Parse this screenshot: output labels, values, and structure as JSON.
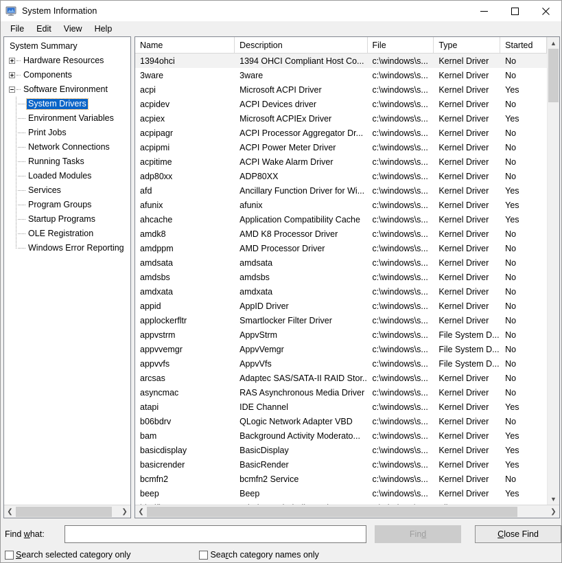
{
  "window": {
    "title": "System Information",
    "icon": "computer-monitor-icon",
    "controls": {
      "minimize": "minimize-icon",
      "maximize": "maximize-icon",
      "close": "close-icon"
    }
  },
  "menubar": {
    "items": [
      "File",
      "Edit",
      "View",
      "Help"
    ]
  },
  "tree": {
    "items": [
      {
        "label": "System Summary",
        "level": 0,
        "expander": "none",
        "selected": false
      },
      {
        "label": "Hardware Resources",
        "level": 1,
        "expander": "plus",
        "selected": false
      },
      {
        "label": "Components",
        "level": 1,
        "expander": "plus",
        "selected": false
      },
      {
        "label": "Software Environment",
        "level": 1,
        "expander": "minus",
        "selected": false
      },
      {
        "label": "System Drivers",
        "level": 2,
        "expander": "leaf",
        "selected": true
      },
      {
        "label": "Environment Variables",
        "level": 2,
        "expander": "leaf",
        "selected": false
      },
      {
        "label": "Print Jobs",
        "level": 2,
        "expander": "leaf",
        "selected": false
      },
      {
        "label": "Network Connections",
        "level": 2,
        "expander": "leaf",
        "selected": false
      },
      {
        "label": "Running Tasks",
        "level": 2,
        "expander": "leaf",
        "selected": false
      },
      {
        "label": "Loaded Modules",
        "level": 2,
        "expander": "leaf",
        "selected": false
      },
      {
        "label": "Services",
        "level": 2,
        "expander": "leaf",
        "selected": false
      },
      {
        "label": "Program Groups",
        "level": 2,
        "expander": "leaf",
        "selected": false
      },
      {
        "label": "Startup Programs",
        "level": 2,
        "expander": "leaf",
        "selected": false
      },
      {
        "label": "OLE Registration",
        "level": 2,
        "expander": "leaf",
        "selected": false
      },
      {
        "label": "Windows Error Reporting",
        "level": 2,
        "expander": "leaf",
        "selected": false
      }
    ]
  },
  "list": {
    "columns": [
      "Name",
      "Description",
      "File",
      "Type",
      "Started"
    ],
    "rows": [
      [
        "1394ohci",
        "1394 OHCI Compliant Host Co...",
        "c:\\windows\\s...",
        "Kernel Driver",
        "No"
      ],
      [
        "3ware",
        "3ware",
        "c:\\windows\\s...",
        "Kernel Driver",
        "No"
      ],
      [
        "acpi",
        "Microsoft ACPI Driver",
        "c:\\windows\\s...",
        "Kernel Driver",
        "Yes"
      ],
      [
        "acpidev",
        "ACPI Devices driver",
        "c:\\windows\\s...",
        "Kernel Driver",
        "No"
      ],
      [
        "acpiex",
        "Microsoft ACPIEx Driver",
        "c:\\windows\\s...",
        "Kernel Driver",
        "Yes"
      ],
      [
        "acpipagr",
        "ACPI Processor Aggregator Dr...",
        "c:\\windows\\s...",
        "Kernel Driver",
        "No"
      ],
      [
        "acpipmi",
        "ACPI Power Meter Driver",
        "c:\\windows\\s...",
        "Kernel Driver",
        "No"
      ],
      [
        "acpitime",
        "ACPI Wake Alarm Driver",
        "c:\\windows\\s...",
        "Kernel Driver",
        "No"
      ],
      [
        "adp80xx",
        "ADP80XX",
        "c:\\windows\\s...",
        "Kernel Driver",
        "No"
      ],
      [
        "afd",
        "Ancillary Function Driver for Wi...",
        "c:\\windows\\s...",
        "Kernel Driver",
        "Yes"
      ],
      [
        "afunix",
        "afunix",
        "c:\\windows\\s...",
        "Kernel Driver",
        "Yes"
      ],
      [
        "ahcache",
        "Application Compatibility Cache",
        "c:\\windows\\s...",
        "Kernel Driver",
        "Yes"
      ],
      [
        "amdk8",
        "AMD K8 Processor Driver",
        "c:\\windows\\s...",
        "Kernel Driver",
        "No"
      ],
      [
        "amdppm",
        "AMD Processor Driver",
        "c:\\windows\\s...",
        "Kernel Driver",
        "No"
      ],
      [
        "amdsata",
        "amdsata",
        "c:\\windows\\s...",
        "Kernel Driver",
        "No"
      ],
      [
        "amdsbs",
        "amdsbs",
        "c:\\windows\\s...",
        "Kernel Driver",
        "No"
      ],
      [
        "amdxata",
        "amdxata",
        "c:\\windows\\s...",
        "Kernel Driver",
        "No"
      ],
      [
        "appid",
        "AppID Driver",
        "c:\\windows\\s...",
        "Kernel Driver",
        "No"
      ],
      [
        "applockerfltr",
        "Smartlocker Filter Driver",
        "c:\\windows\\s...",
        "Kernel Driver",
        "No"
      ],
      [
        "appvstrm",
        "AppvStrm",
        "c:\\windows\\s...",
        "File System D...",
        "No"
      ],
      [
        "appvvemgr",
        "AppvVemgr",
        "c:\\windows\\s...",
        "File System D...",
        "No"
      ],
      [
        "appvvfs",
        "AppvVfs",
        "c:\\windows\\s...",
        "File System D...",
        "No"
      ],
      [
        "arcsas",
        "Adaptec SAS/SATA-II RAID Stor...",
        "c:\\windows\\s...",
        "Kernel Driver",
        "No"
      ],
      [
        "asyncmac",
        "RAS Asynchronous Media Driver",
        "c:\\windows\\s...",
        "Kernel Driver",
        "No"
      ],
      [
        "atapi",
        "IDE Channel",
        "c:\\windows\\s...",
        "Kernel Driver",
        "Yes"
      ],
      [
        "b06bdrv",
        "QLogic Network Adapter VBD",
        "c:\\windows\\s...",
        "Kernel Driver",
        "No"
      ],
      [
        "bam",
        "Background Activity Moderato...",
        "c:\\windows\\s...",
        "Kernel Driver",
        "Yes"
      ],
      [
        "basicdisplay",
        "BasicDisplay",
        "c:\\windows\\s...",
        "Kernel Driver",
        "Yes"
      ],
      [
        "basicrender",
        "BasicRender",
        "c:\\windows\\s...",
        "Kernel Driver",
        "Yes"
      ],
      [
        "bcmfn2",
        "bcmfn2 Service",
        "c:\\windows\\s...",
        "Kernel Driver",
        "No"
      ],
      [
        "beep",
        "Beep",
        "c:\\windows\\s...",
        "Kernel Driver",
        "Yes"
      ],
      [
        "bindflt",
        "Windows Bind Filter Driver",
        "c:\\windows\\s...",
        "File System D...",
        "No"
      ]
    ]
  },
  "findbar": {
    "label_prefix": "Find ",
    "label_mnemonic": "w",
    "label_suffix": "hat:",
    "input_value": "",
    "find_button": {
      "prefix": "Fin",
      "mnemonic": "d",
      "suffix": "",
      "disabled": true
    },
    "close_find_button": {
      "prefix": "",
      "mnemonic": "C",
      "suffix": "lose Find"
    },
    "checkbox1": {
      "prefix": "",
      "mnemonic": "S",
      "suffix": "earch selected category only",
      "checked": false
    },
    "checkbox2": {
      "prefix": "Sea",
      "mnemonic": "r",
      "suffix": "ch category names only",
      "checked": false
    }
  },
  "colors": {
    "selection_blue": "#0a64c8",
    "window_bg": "#f0f0f0",
    "pane_bg": "#ffffff",
    "disabled_gray": "#cccccc",
    "scroll_thumb": "#cdcdcd"
  }
}
